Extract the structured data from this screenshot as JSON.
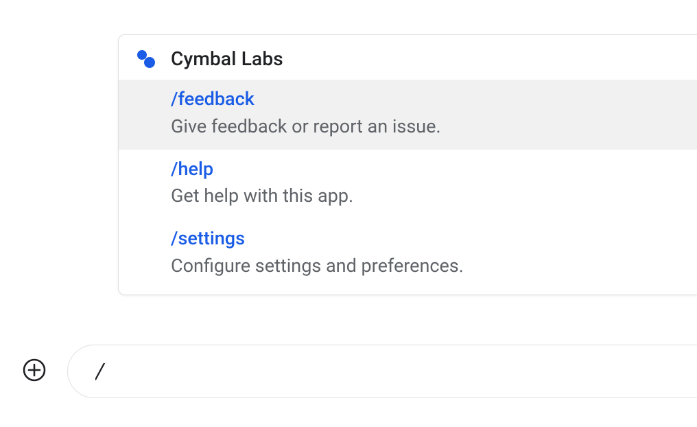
{
  "popup": {
    "app_title": "Cymbal Labs",
    "commands": [
      {
        "name": "/feedback",
        "desc": "Give feedback or report an issue.",
        "highlighted": true
      },
      {
        "name": "/help",
        "desc": "Get help with this app.",
        "highlighted": false
      },
      {
        "name": "/settings",
        "desc": "Configure settings and preferences.",
        "highlighted": false
      }
    ]
  },
  "input": {
    "value": "/"
  },
  "colors": {
    "command_blue": "#1a5ce6",
    "icon_blue": "#1a5ce6",
    "highlight_bg": "#f1f1f1",
    "text_gray": "#5f6368"
  }
}
